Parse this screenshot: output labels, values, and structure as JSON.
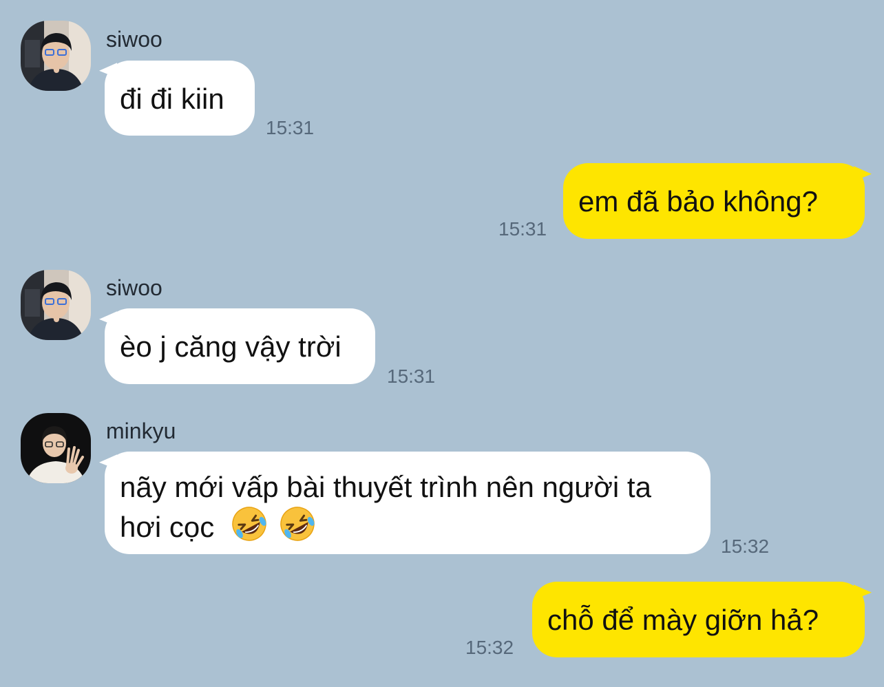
{
  "messages": [
    {
      "sender": "siwoo",
      "text": "đi đi kiin",
      "time": "15:31"
    },
    {
      "text": "em đã bảo không?",
      "time": "15:31"
    },
    {
      "sender": "siwoo",
      "text": "èo j căng vậy trời",
      "time": "15:31"
    },
    {
      "sender": "minkyu",
      "line1": "nãy mới vấp bài thuyết trình nên người ta",
      "line2": "hơi cọc",
      "emoji": "rolling-on-floor-laughing",
      "time": "15:32"
    },
    {
      "text": "chỗ để mày giỡn hả?",
      "time": "15:32"
    }
  ],
  "colors": {
    "background": "#abc1d2",
    "incoming_bubble": "#ffffff",
    "outgoing_bubble": "#fee500",
    "timestamp": "#56687a"
  }
}
